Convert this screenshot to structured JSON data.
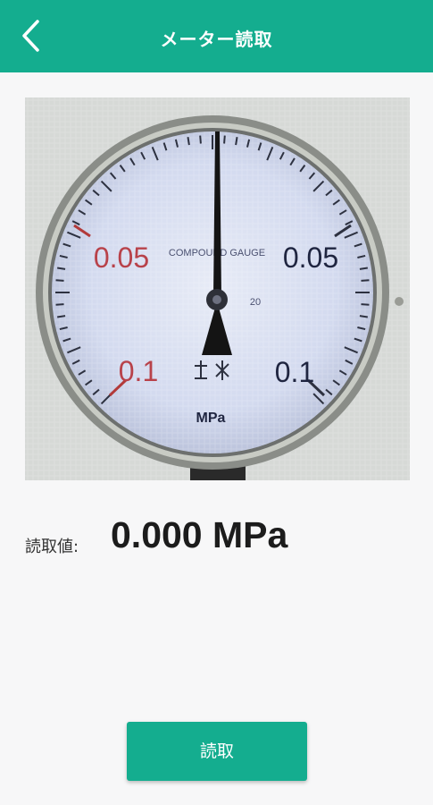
{
  "header": {
    "title": "メーター読取",
    "back_icon": "chevron-left-icon",
    "background_color": "#14ad8f"
  },
  "gauge": {
    "dial_text": "COMPOUND GAUGE",
    "left_upper_label": "0.05",
    "right_upper_label": "0.05",
    "left_lower_label": "0.1",
    "right_lower_label": "0.1",
    "unit": "MPa",
    "center_text": "20"
  },
  "reading": {
    "label": "読取値:",
    "value": "0.000 MPa"
  },
  "actions": {
    "read_button_label": "読取",
    "button_color": "#14ad8f"
  }
}
